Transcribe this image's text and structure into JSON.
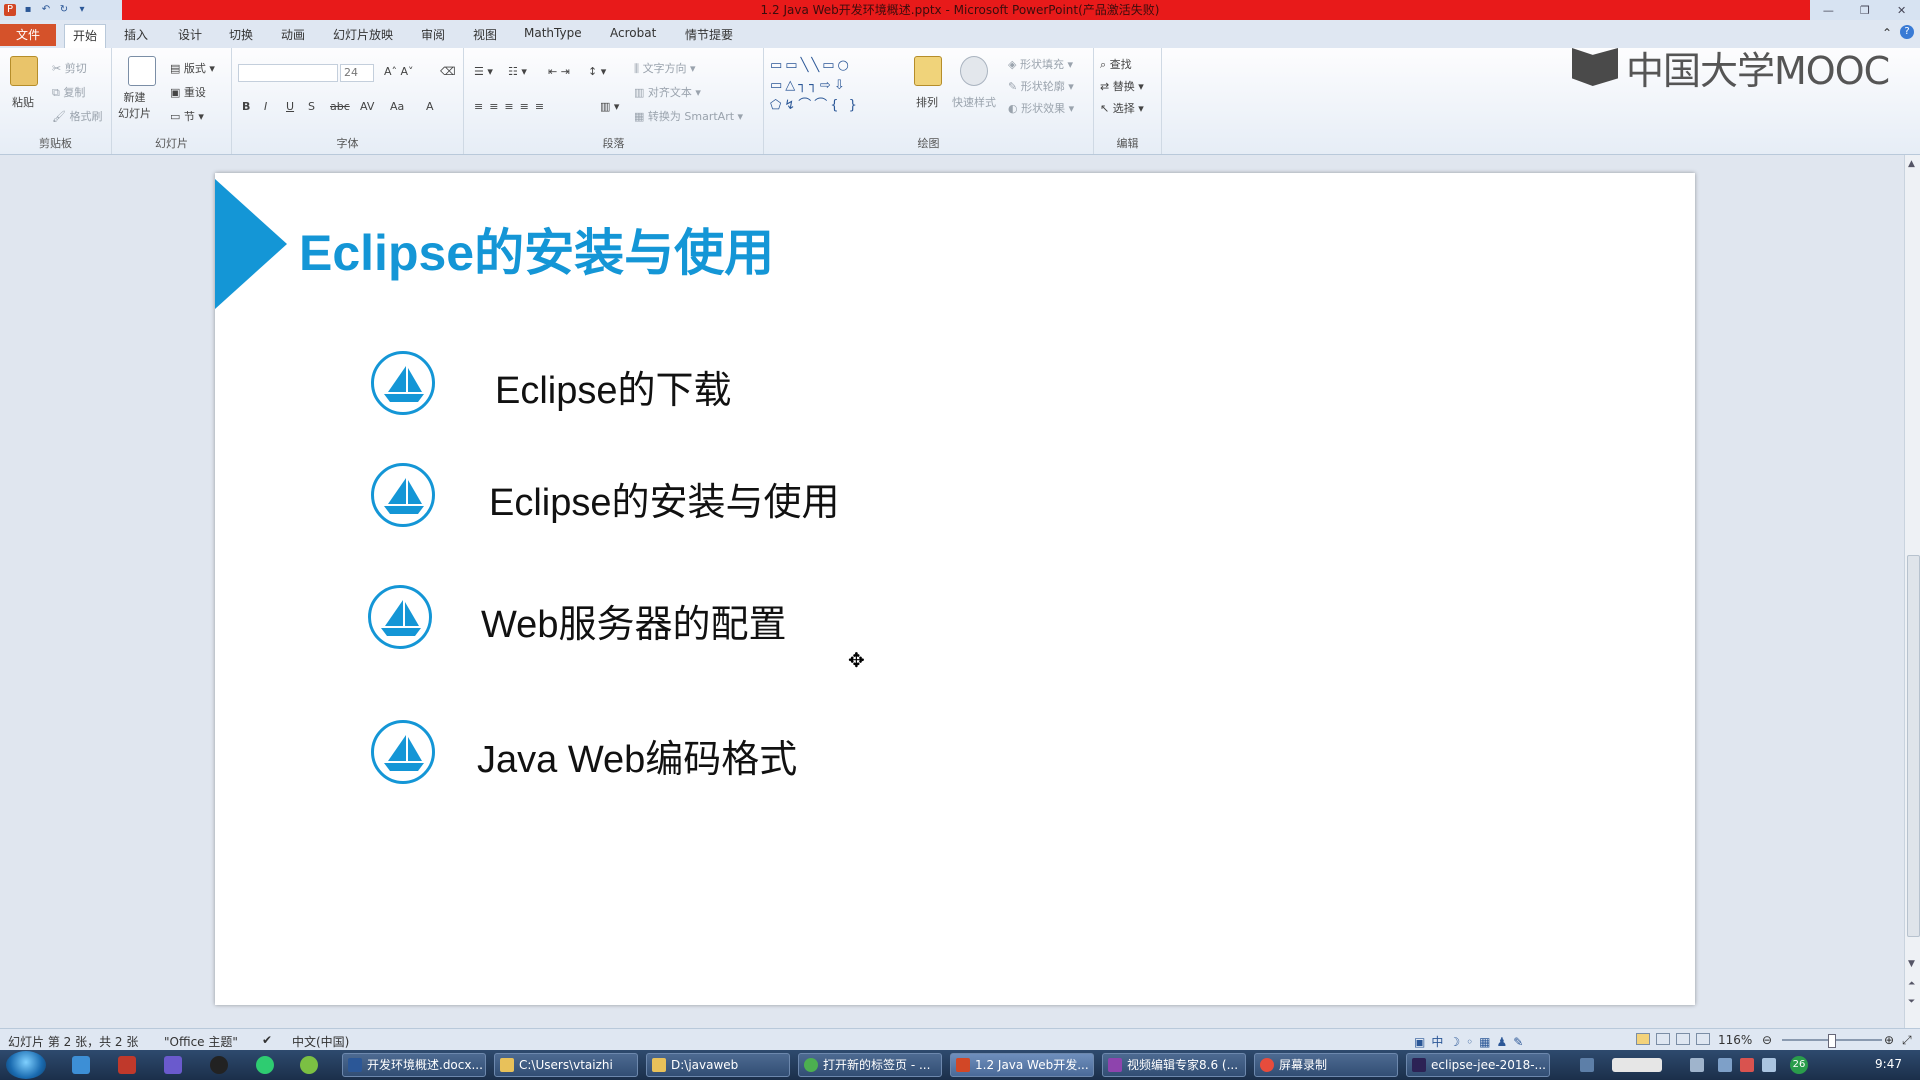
{
  "window": {
    "title": "1.2 Java Web开发环境概述.pptx - Microsoft PowerPoint(产品激活失败)"
  },
  "ribbon_tabs": [
    "文件",
    "开始",
    "插入",
    "设计",
    "切换",
    "动画",
    "幻灯片放映",
    "审阅",
    "视图",
    "MathType",
    "Acrobat",
    "情节提要"
  ],
  "ribbon": {
    "clipboard": {
      "paste": "粘贴",
      "cut": "剪切",
      "copy": "复制",
      "format_painter": "格式刷",
      "label": "剪贴板"
    },
    "slides": {
      "new_slide": "新建\n幻灯片",
      "layout": "版式",
      "reset": "重设",
      "section": "节",
      "label": "幻灯片"
    },
    "font": {
      "size": "24",
      "label": "字体"
    },
    "paragraph": {
      "text_direction": "文字方向",
      "align_text": "对齐文本",
      "smartart": "转换为 SmartArt",
      "label": "段落"
    },
    "drawing": {
      "arrange": "排列",
      "quick_styles": "快速样式",
      "shape_fill": "形状填充",
      "shape_outline": "形状轮廓",
      "shape_effects": "形状效果",
      "label": "绘图"
    },
    "editing": {
      "find": "查找",
      "replace": "替换",
      "select": "选择",
      "label": "编辑"
    }
  },
  "watermark": {
    "text": "中国大学MOOC"
  },
  "slide": {
    "title": "Eclipse的安装与使用",
    "items": [
      {
        "label": "Eclipse的下载"
      },
      {
        "label": "Eclipse的安装与使用"
      },
      {
        "label": "Web服务器的配置"
      },
      {
        "label": "Java Web编码格式"
      }
    ],
    "accent_color": "#1496d6"
  },
  "statusbar": {
    "slide_info": "幻灯片 第 2 张，共 2 张",
    "theme": "\"Office 主题\"",
    "language": "中文(中国)",
    "zoom": "116%"
  },
  "taskbar": {
    "items": [
      {
        "label": "开发环境概述.docx..."
      },
      {
        "label": "C:\\Users\\vtaizhi"
      },
      {
        "label": "D:\\javaweb"
      },
      {
        "label": "打开新的标签页 - ..."
      },
      {
        "label": "1.2 Java Web开发..."
      },
      {
        "label": "视频编辑专家8.6 (..."
      },
      {
        "label": "屏幕录制"
      },
      {
        "label": "eclipse-jee-2018-..."
      }
    ],
    "clock": "9:47",
    "badge": "26"
  }
}
